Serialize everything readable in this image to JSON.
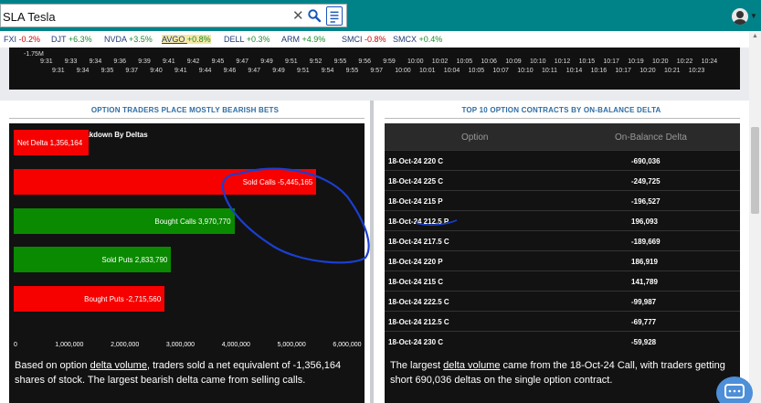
{
  "search": {
    "value": "SLA Tesla"
  },
  "tickers": [
    {
      "sym": "FXI",
      "chg": "-0.2%",
      "dir": "neg"
    },
    {
      "sym": "DJT",
      "chg": "+6.3%",
      "dir": "pos"
    },
    {
      "sym": "NVDA",
      "chg": "+3.5%",
      "dir": "pos"
    },
    {
      "sym": "AVGO",
      "chg": "+0.8%",
      "dir": "pos",
      "hl": true
    },
    {
      "sym": "DELL",
      "chg": "+0.3%",
      "dir": "pos"
    },
    {
      "sym": "ARM",
      "chg": "+4.9%",
      "dir": "pos"
    },
    {
      "sym": "SMCI",
      "chg": "-0.8%",
      "dir": "neg"
    },
    {
      "sym": "SMCX",
      "chg": "+0.4%",
      "dir": "pos"
    }
  ],
  "top_chart": {
    "y_label": "-1.75M",
    "x_row1": [
      "9:31",
      "9:33",
      "9:34",
      "9:36",
      "9:39",
      "9:41",
      "9:42",
      "9:45",
      "9:47",
      "9:49",
      "9:51",
      "9:52",
      "9:55",
      "9:56",
      "9:59",
      "10:00",
      "10:02",
      "10:05",
      "10:06",
      "10:09",
      "10:10",
      "10:12",
      "10:15",
      "10:17",
      "10:19",
      "10:20",
      "10:22",
      "10:24"
    ],
    "x_row2": [
      "9:31",
      "9:34",
      "9:35",
      "9:37",
      "9:40",
      "9:41",
      "9:44",
      "9:46",
      "9:47",
      "9:49",
      "9:51",
      "9:54",
      "9:55",
      "9:57",
      "10:00",
      "10:01",
      "10:04",
      "10:05",
      "10:07",
      "10:10",
      "10:11",
      "10:14",
      "10:16",
      "10:17",
      "10:20",
      "10:21",
      "10:23"
    ]
  },
  "left_panel": {
    "title": "OPTION TRADERS PLACE MOSTLY BEARISH BETS",
    "caption_pre": "Based on option ",
    "caption_link": "delta volume",
    "caption_post": ", traders sold a net equivalent of -1,356,164 shares of stock. The largest bearish delta came from selling calls."
  },
  "chart_data": {
    "type": "bar",
    "orientation": "horizontal",
    "title": "Order Sentiment Breakdown By Deltas",
    "categories": [
      "Net Delta",
      "Sold Calls",
      "Bought Calls",
      "Sold Puts",
      "Bought Puts"
    ],
    "values": [
      1356164,
      -5445165,
      3970770,
      2833790,
      -2715560
    ],
    "bar_labels": [
      "Net Delta 1,356,164",
      "Sold Calls -5,445,165",
      "Bought Calls 3,970,770",
      "Sold Puts 2,833,790",
      "Bought Puts -2,715,560"
    ],
    "colors": [
      "#f70000",
      "#f70000",
      "#0a8a00",
      "#0a8a00",
      "#f70000"
    ],
    "x_ticks": [
      "0",
      "1,000,000",
      "2,000,000",
      "3,000,000",
      "4,000,000",
      "5,000,000",
      "6,000,000"
    ],
    "xlim": [
      0,
      6000000
    ],
    "note": "bar lengths drawn from absolute values"
  },
  "right_panel": {
    "title": "TOP 10 OPTION CONTRACTS BY ON-BALANCE DELTA",
    "col_option": "Option",
    "col_delta": "On-Balance Delta",
    "rows": [
      {
        "option": "18-Oct-24 220 C",
        "delta": "-690,036"
      },
      {
        "option": "18-Oct-24 225 C",
        "delta": "-249,725"
      },
      {
        "option": "18-Oct-24 215 P",
        "delta": "-196,527"
      },
      {
        "option": "18-Oct-24 212.5 P",
        "delta": "196,093"
      },
      {
        "option": "18-Oct-24 217.5 C",
        "delta": "-189,669"
      },
      {
        "option": "18-Oct-24 220 P",
        "delta": "186,919"
      },
      {
        "option": "18-Oct-24 215 C",
        "delta": "141,789"
      },
      {
        "option": "18-Oct-24 222.5 C",
        "delta": "-99,987"
      },
      {
        "option": "18-Oct-24 212.5 C",
        "delta": "-69,777"
      },
      {
        "option": "18-Oct-24 230 C",
        "delta": "-59,928"
      }
    ],
    "caption_pre": "The largest ",
    "caption_link": "delta volume",
    "caption_post": " came from the 18-Oct-24 Call, with traders getting short 690,036 deltas on the single option contract."
  },
  "colors": {
    "topbar": "#008289",
    "accent_title": "#2e6da4",
    "annotation": "#1a3fd0"
  }
}
